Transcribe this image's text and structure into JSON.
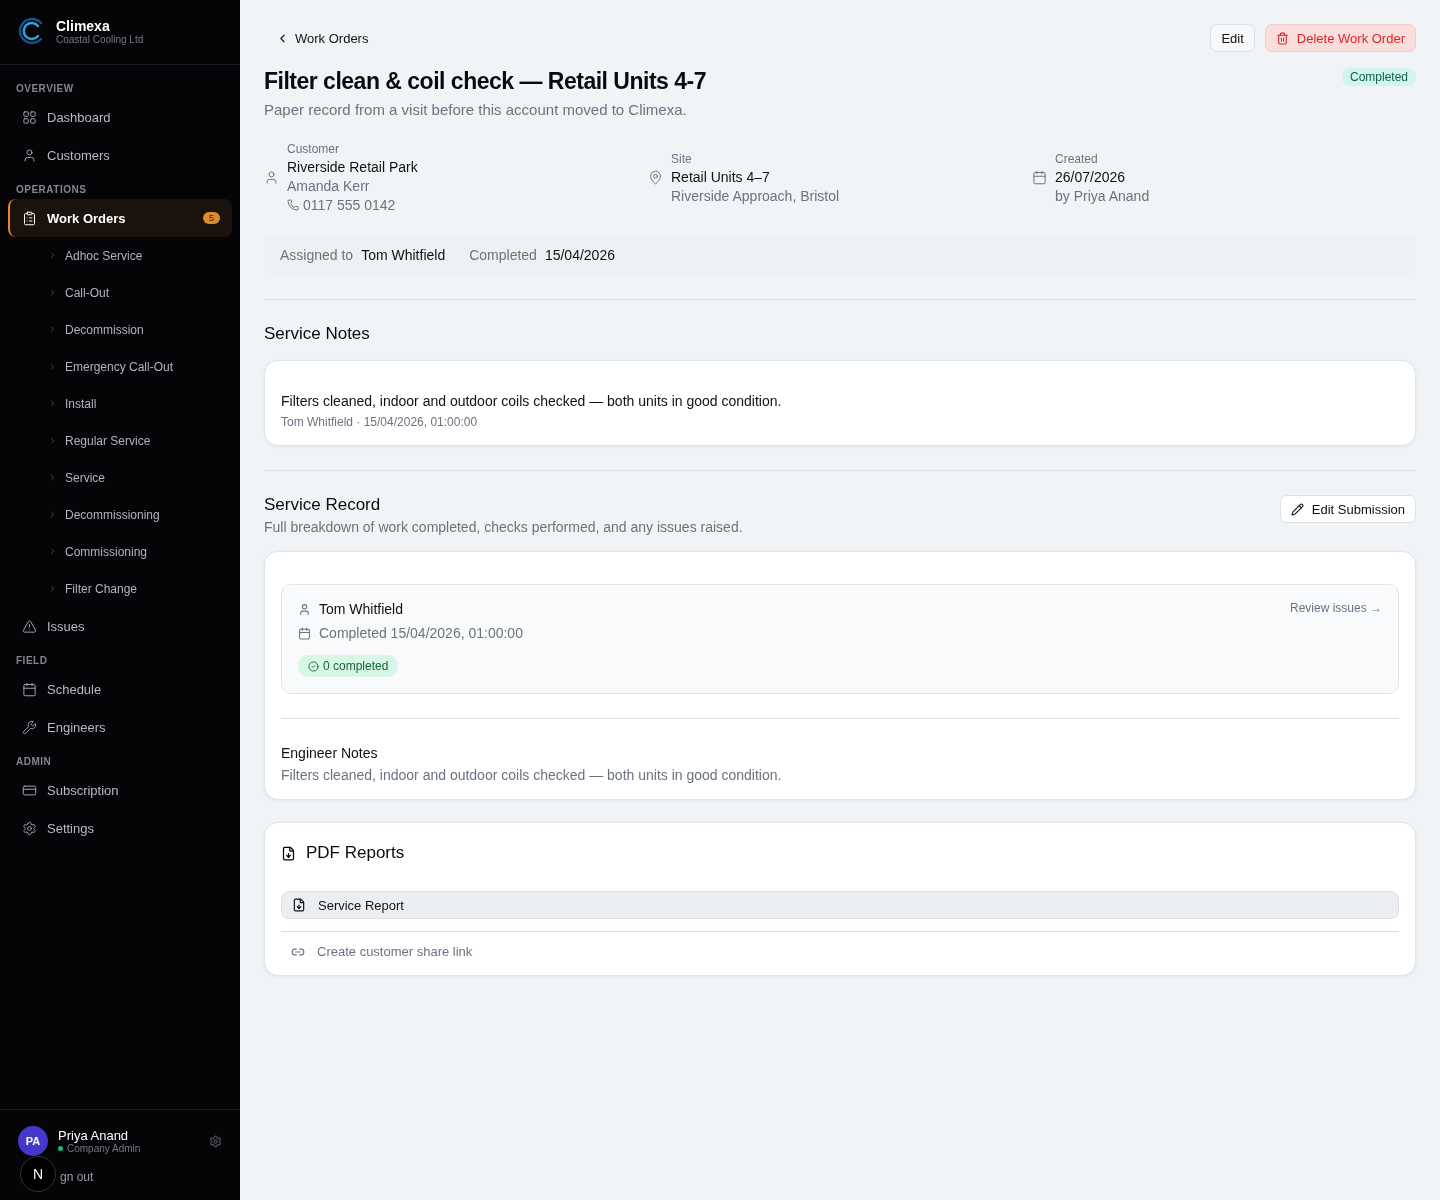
{
  "brand": {
    "name": "Climexa",
    "company": "Coastal Cooling Ltd"
  },
  "sidebar": {
    "sections": [
      {
        "heading": "OVERVIEW",
        "items": [
          {
            "label": "Dashboard",
            "kind": "grid",
            "selected": false
          },
          {
            "label": "Customers",
            "kind": "user",
            "selected": false
          }
        ]
      },
      {
        "heading": "OPERATIONS",
        "items": [
          {
            "label": "Work Orders",
            "kind": "clipboard",
            "selected": true,
            "badge": "5",
            "children": [
              {
                "label": "Adhoc Service"
              },
              {
                "label": "Call-Out"
              },
              {
                "label": "Decommission"
              },
              {
                "label": "Emergency Call-Out"
              },
              {
                "label": "Install"
              },
              {
                "label": "Regular Service"
              },
              {
                "label": "Service"
              },
              {
                "label": "Decommissioning"
              },
              {
                "label": "Commissioning"
              },
              {
                "label": "Filter Change"
              }
            ]
          },
          {
            "label": "Issues",
            "kind": "alert",
            "selected": false
          }
        ]
      },
      {
        "heading": "FIELD",
        "items": [
          {
            "label": "Schedule",
            "kind": "calendar",
            "selected": false
          },
          {
            "label": "Engineers",
            "kind": "wrench",
            "selected": false
          }
        ]
      },
      {
        "heading": "ADMIN",
        "items": [
          {
            "label": "Subscription",
            "kind": "card",
            "selected": false
          },
          {
            "label": "Settings",
            "kind": "gear",
            "selected": false
          }
        ]
      }
    ]
  },
  "user": {
    "initials": "PA",
    "name": "Priya Anand",
    "role": "Company Admin",
    "sign_out": "gn out",
    "dev_badge": "N"
  },
  "header": {
    "back": "Work Orders",
    "edit": "Edit",
    "delete": "Delete Work Order"
  },
  "title": "Filter clean & coil check — Retail Units 4-7",
  "subtitle": "Paper record from a visit before this account moved to Climexa.",
  "status": "Completed",
  "details": [
    {
      "kind": "user",
      "label": "Customer",
      "lines": [
        "Riverside Retail Park",
        "Amanda Kerr"
      ],
      "phone": "0117 555 0142"
    },
    {
      "kind": "pin",
      "label": "Site",
      "lines": [
        "Retail Units 4–7",
        "Riverside Approach, Bristol"
      ]
    },
    {
      "kind": "calendar",
      "label": "Created",
      "lines": [
        "26/07/2026",
        "by Priya Anand"
      ]
    }
  ],
  "assignment": [
    {
      "label": "Assigned to",
      "value": "Tom Whitfield"
    },
    {
      "label": "Completed",
      "value": "15/04/2026"
    }
  ],
  "service_notes": {
    "heading": "Service Notes",
    "text": "Filters cleaned, indoor and outdoor coils checked — both units in good condition.",
    "meta": "Tom Whitfield · 15/04/2026, 01:00:00"
  },
  "service_record": {
    "heading": "Service Record",
    "description": "Full breakdown of work completed, checks performed, and any issues raised.",
    "edit": "Edit Submission",
    "engineer": "Tom Whitfield",
    "completed": "Completed 15/04/2026, 01:00:00",
    "review": "Review issues →",
    "count": "0 completed",
    "notes_heading": "Engineer Notes",
    "notes": "Filters cleaned, indoor and outdoor coils checked — both units in good condition."
  },
  "pdf": {
    "heading": "PDF Reports",
    "reports": [
      "Service Report"
    ],
    "share": "Create customer share link"
  }
}
